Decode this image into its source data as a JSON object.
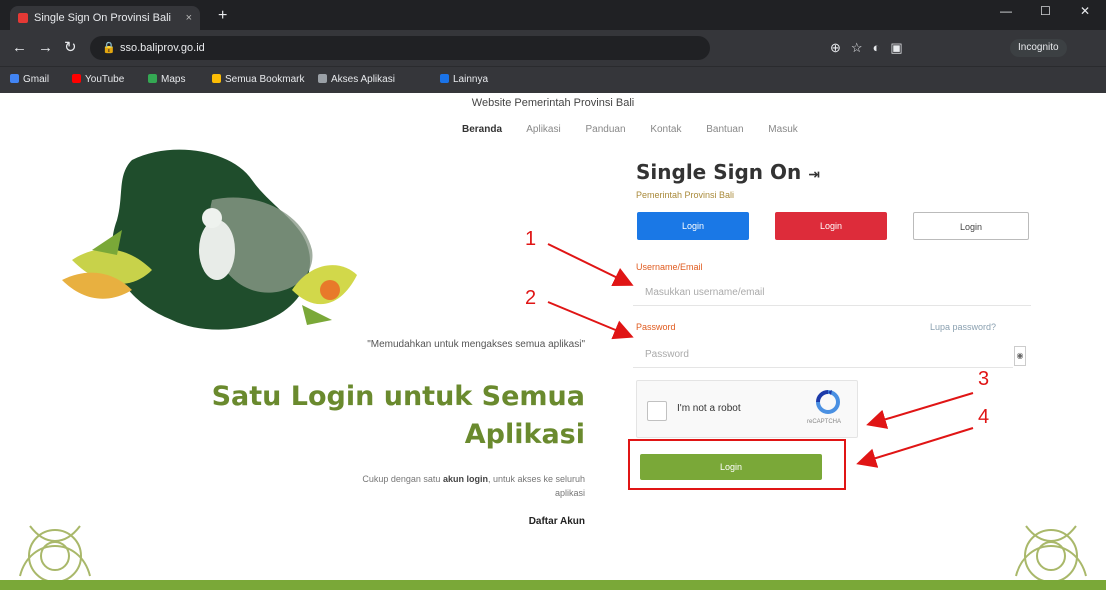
{
  "browser": {
    "tab_title": "Single Sign On Provinsi Bali",
    "tab_close": "×",
    "new_tab": "+",
    "window_controls": [
      "—",
      "☐",
      "✕"
    ],
    "url": "sso.baliprov.go.id",
    "profile_label": "Incognito",
    "bookmarks": [
      {
        "label": "Gmail",
        "color": "#4285f4"
      },
      {
        "label": "YouTube",
        "color": "#ff0000"
      },
      {
        "label": "Maps",
        "color": "#34a853"
      },
      {
        "label": "Semua Bookmark",
        "color": "#fbbc05"
      },
      {
        "label": "Akses Aplikasi",
        "color": "#9aa0a6"
      },
      {
        "label": "Lainnya",
        "color": "#1a73e8"
      }
    ]
  },
  "site": {
    "title": "Website Pemerintah Provinsi Bali",
    "nav": [
      "Beranda",
      "Aplikasi",
      "Panduan",
      "Kontak",
      "Bantuan",
      "Masuk"
    ],
    "quote": "\"Memudahkan untuk mengakses semua aplikasi\"",
    "headline_line1": "Satu Login untuk Semua",
    "headline_line2": "Aplikasi",
    "description_pre": "Cukup dengan satu",
    "description_bold": "akun login",
    "description_post": ", untuk akses ke seluruh aplikasi",
    "register_link": "Daftar Akun"
  },
  "sso": {
    "title": "Single Sign On",
    "title_icon": "sign-in-icon",
    "subtitle": "Pemerintah Provinsi Bali",
    "btn_blue": "Login",
    "btn_red": "Login",
    "btn_plain": "Login",
    "username_label": "Username/Email",
    "username_placeholder": "Masukkan username/email",
    "password_label": "Password",
    "forgot_link": "Lupa password?",
    "password_placeholder": "Password",
    "captcha_text": "I'm not a robot",
    "captcha_brand": "reCAPTCHA",
    "login_button": "Login"
  },
  "annotations": [
    "1",
    "2",
    "3",
    "4"
  ],
  "colors": {
    "accent_green": "#7aa838",
    "headline_green": "#6a8a2e",
    "annotation_red": "#e01515"
  }
}
